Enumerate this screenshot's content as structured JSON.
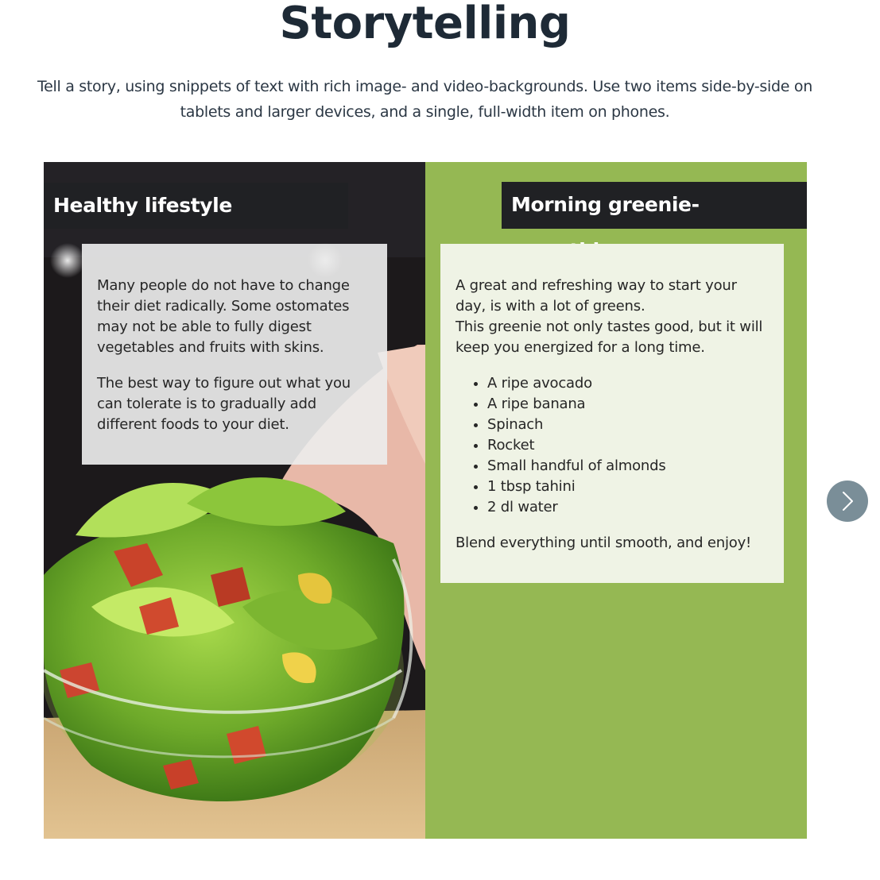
{
  "page": {
    "title": "Storytelling",
    "intro": "Tell a story, using snippets of text with rich image- and video-backgrounds. Use two items side-by-side on tablets and larger devices, and a single, full-width item on phones."
  },
  "stories": [
    {
      "heading": "Healthy lifestyle",
      "paragraphs": [
        "Many people do not have to change their diet radically. Some ostomates may not be able to fully digest vegetables and fruits with skins.",
        "The best way to figure out what you can tolerate is to gradually add different foods to your diet."
      ]
    },
    {
      "heading": "Morning greenie-smoothie",
      "intro_line_1": "A great and refreshing way to start your day, is with a lot of greens.",
      "intro_line_2": "This greenie not only tastes good, but it will keep you energized for a long time.",
      "ingredients": [
        "A ripe avocado",
        "A ripe banana",
        "Spinach",
        "Rocket",
        "Small handful of almonds",
        "1 tbsp tahini",
        "2 dl water"
      ],
      "closing": "Blend everything until smooth, and enjoy!"
    }
  ],
  "controls": {
    "next_icon": "chevron-right-icon"
  },
  "colors": {
    "title": "#1e2a36",
    "right_background": "#95b853",
    "right_card": "#eff3e5",
    "heading_bar": "#202124",
    "next_button": "#7a8e98"
  }
}
